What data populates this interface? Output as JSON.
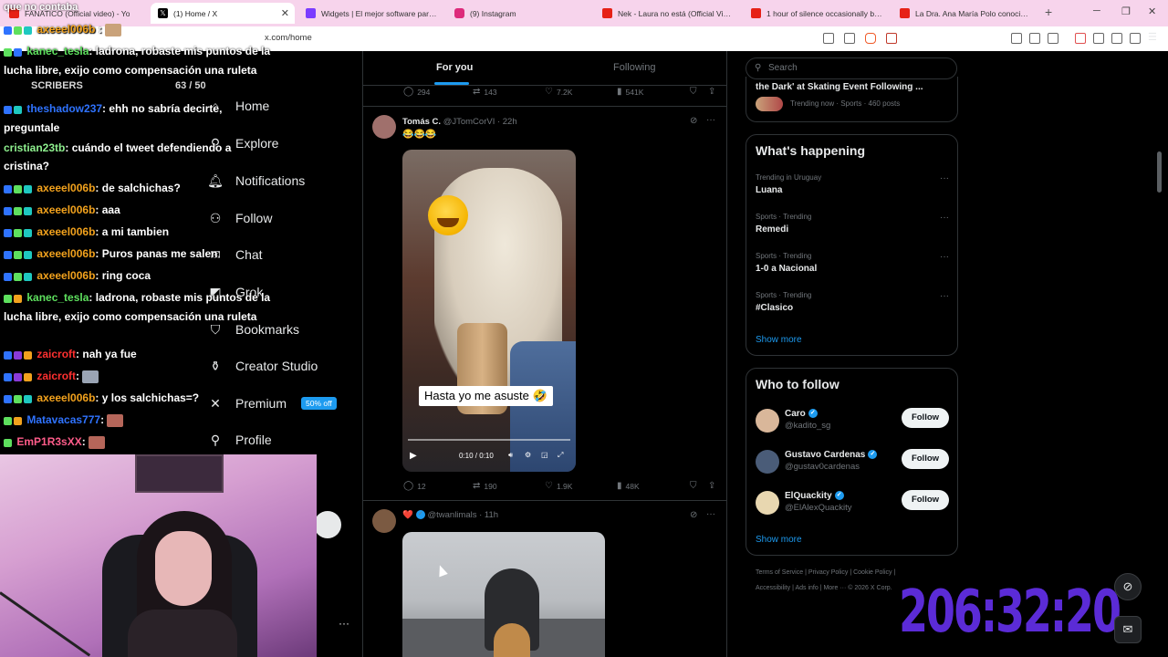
{
  "browser": {
    "tabs": [
      {
        "label": "FANATICO (Official video) - Yo",
        "color": "#e62117"
      },
      {
        "label": "(1) Home / X",
        "color": "#000000",
        "active": true
      },
      {
        "label": "Widgets | El mejor software para pd",
        "color": "#7a3cff"
      },
      {
        "label": "(9) Instagram",
        "color": "#dd2a7b"
      },
      {
        "label": "Nek - Laura no está (Official Video)",
        "color": "#e62117"
      },
      {
        "label": "1 hour of silence occasionally broke",
        "color": "#e62117"
      },
      {
        "label": "La Dra. Ana María Polo conoció a su",
        "color": "#e62117"
      }
    ],
    "url": "x.com/home"
  },
  "overlay": {
    "top_chat": "que no contaba",
    "subscribers_label": "SCRIBERS",
    "subscribers_count": "63  / 50",
    "chat": [
      {
        "user": "axeeel006b",
        "color": "orange",
        "msg": ""
      },
      {
        "user": "kanec_tesla",
        "color": "green",
        "msg": ": ladrona, robaste mis puntos de la lucha libre, exijo como compensación una ruleta"
      },
      {
        "user": "theshadow237",
        "color": "blue",
        "msg": ": ehh no sabría decirte, preguntale"
      },
      {
        "user": "cristian23tb",
        "color": "lgreen",
        "msg": ": cuándo el tweet defendiendo a cristina?"
      },
      {
        "user": "axeeel006b",
        "color": "orange",
        "msg": ": de salchichas?"
      },
      {
        "user": "axeeel006b",
        "color": "orange",
        "msg": ": aaa"
      },
      {
        "user": "axeeel006b",
        "color": "orange",
        "msg": ": a mi tambien"
      },
      {
        "user": "axeeel006b",
        "color": "orange",
        "msg": ": Puros panas me salen"
      },
      {
        "user": "axeeel006b",
        "color": "orange",
        "msg": ": ring coca"
      },
      {
        "user": "kanec_tesla",
        "color": "green",
        "msg": ": ladrona, robaste mis puntos de la lucha libre, exijo como compensación una ruleta"
      },
      {
        "user": "zaicroft",
        "color": "red",
        "msg": ": nah ya fue"
      },
      {
        "user": "zaicroft",
        "color": "red",
        "msg": ":"
      },
      {
        "user": "axeeel006b",
        "color": "orange",
        "msg": ": y los salchichas=?"
      },
      {
        "user": "Matavacas777",
        "color": "blue",
        "msg": ":"
      },
      {
        "user": "EmP1R3sXX",
        "color": "pink",
        "msg": ":"
      }
    ],
    "timer": "206:32:20"
  },
  "nav": {
    "home": "Home",
    "explore": "Explore",
    "notifications": "Notifications",
    "follow": "Follow",
    "chat": "Chat",
    "grok": "Grok",
    "bookmarks": "Bookmarks",
    "creator_studio": "Creator Studio",
    "premium": "Premium",
    "premium_badge": "50% off",
    "profile": "Profile"
  },
  "feed": {
    "tabs": {
      "for_you": "For you",
      "following": "Following"
    },
    "top_stats": {
      "replies": "294",
      "reposts": "143",
      "likes": "7.2K",
      "views": "541K"
    },
    "tweet1": {
      "name": "Tomás C.",
      "handle": "@JTomCorVI · 22h",
      "text": "😂😂😂",
      "caption": "Hasta yo me asuste 🤣",
      "time": "0:10 / 0:10",
      "stats": {
        "replies": "12",
        "reposts": "190",
        "likes": "1.9K",
        "views": "48K"
      }
    },
    "tweet2": {
      "name": "❤️",
      "handle": "@twanlimals · 11h"
    }
  },
  "sidebar_right": {
    "search_placeholder": "Search",
    "top_trend": {
      "text": "the Dark' at Skating Event Following ...",
      "meta": "Trending now · Sports · 460 posts"
    },
    "whats_happening": "What's happening",
    "trends": [
      {
        "cat": "Trending in Uruguay",
        "name": "Luana"
      },
      {
        "cat": "Sports · Trending",
        "name": "Remedi"
      },
      {
        "cat": "Sports · Trending",
        "name": "1-0 a Nacional"
      },
      {
        "cat": "Sports · Trending",
        "name": "#Clasico"
      }
    ],
    "show_more": "Show more",
    "who_to_follow": "Who to follow",
    "follow_suggestions": [
      {
        "name": "Caro",
        "handle": "@kadito_sg",
        "button": "Follow"
      },
      {
        "name": "Gustavo Cardenas",
        "handle": "@gustav0cardenas",
        "button": "Follow"
      },
      {
        "name": "ElQuackity",
        "handle": "@ElAlexQuackity",
        "button": "Follow"
      }
    ],
    "show_more2": "Show more",
    "footer1": "Terms of Service  |  Privacy Policy  |  Cookie Policy  |",
    "footer2": "Accessibility  |  Ads info  |  More ···  © 2026 X Corp."
  }
}
